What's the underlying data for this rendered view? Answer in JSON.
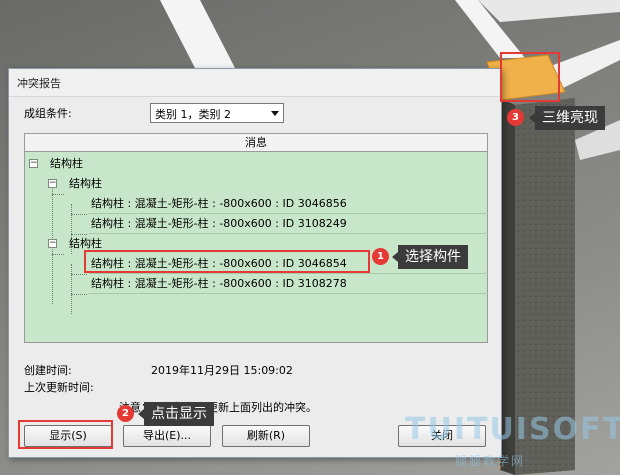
{
  "dialog": {
    "title": "冲突报告",
    "group_label": "成组条件:",
    "group_value": "类别 1，类别 2",
    "tree_header": "消息",
    "tree": {
      "root": "结构柱",
      "groups": [
        {
          "label": "结构柱",
          "items": [
            "结构柱 : 混凝土-矩形-柱 : -800x600 : ID 3046856",
            "结构柱 : 混凝土-矩形-柱 : -800x600 : ID 3108249"
          ]
        },
        {
          "label": "结构柱",
          "items": [
            "结构柱 : 混凝土-矩形-柱 : -800x600 : ID 3046854",
            "结构柱 : 混凝土-矩形-柱 : -800x600 : ID 3108278"
          ]
        }
      ]
    },
    "created_label": "创建时间:",
    "created_value": "2019年11月29日 15:09:02",
    "updated_label": "上次更新时间:",
    "note": "注意：刷新操作会更新上面列出的冲突。",
    "buttons": {
      "show": "显示(S)",
      "export": "导出(E)...",
      "refresh": "刷新(R)",
      "close": "关闭"
    }
  },
  "annotations": [
    {
      "number": "1",
      "text": "选择构件"
    },
    {
      "number": "2",
      "text": "点击显示"
    },
    {
      "number": "3",
      "text": "三维亮现"
    }
  ],
  "watermark": {
    "main": "TUITUISOFT",
    "sub": "腿腿教学网"
  },
  "colors": {
    "tree_bg": "#c8e6c9",
    "annotation_red": "#e53935",
    "highlight_orange": "#f0b04a"
  }
}
